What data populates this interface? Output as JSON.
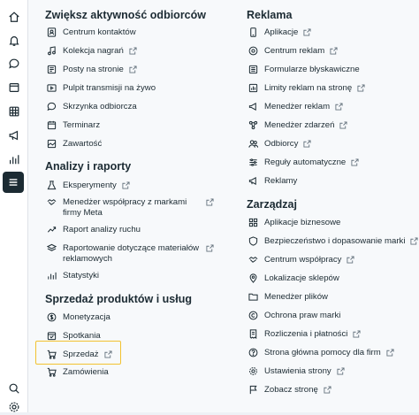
{
  "rail": {
    "icons": [
      "home-icon",
      "bell-icon",
      "chat-icon",
      "pages-icon",
      "table-icon",
      "megaphone-icon",
      "chart-icon",
      "menu-icon",
      "search-icon",
      "settings-icon"
    ]
  },
  "sections": {
    "engage": {
      "title": "Zwiększ aktywność odbiorców",
      "items": [
        {
          "label": "Centrum kontaktów",
          "icon": "contacts-icon",
          "external": false
        },
        {
          "label": "Kolekcja nagrań",
          "icon": "music-note-icon",
          "external": true
        },
        {
          "label": "Posty na stronie",
          "icon": "posts-icon",
          "external": true
        },
        {
          "label": "Pulpit transmisji na żywo",
          "icon": "live-icon",
          "external": false
        },
        {
          "label": "Skrzynka odbiorcza",
          "icon": "inbox-icon",
          "external": false
        },
        {
          "label": "Terminarz",
          "icon": "calendar-icon",
          "external": false
        },
        {
          "label": "Zawartość",
          "icon": "content-icon",
          "external": false
        }
      ]
    },
    "analytics": {
      "title": "Analizy i raporty",
      "items": [
        {
          "label": "Eksperymenty",
          "icon": "flask-icon",
          "external": true
        },
        {
          "label": "Menedżer współpracy z markami firmy Meta",
          "icon": "handshake-icon",
          "external": true
        },
        {
          "label": "Raport analizy ruchu",
          "icon": "traffic-icon",
          "external": false
        },
        {
          "label": "Raportowanie dotyczące materiałów reklamowych",
          "icon": "layers-icon",
          "external": true
        },
        {
          "label": "Statystyki",
          "icon": "stats-icon",
          "external": false
        }
      ]
    },
    "sales": {
      "title": "Sprzedaż produktów i usług",
      "items": [
        {
          "label": "Monetyzacja",
          "icon": "dollar-icon",
          "external": false
        },
        {
          "label": "Spotkania",
          "icon": "meeting-icon",
          "external": false
        },
        {
          "label": "Sprzedaż",
          "icon": "cart-icon",
          "external": true
        },
        {
          "label": "Zamówienia",
          "icon": "orders-icon",
          "external": false
        }
      ]
    },
    "ads": {
      "title": "Reklama",
      "items": [
        {
          "label": "Aplikacje",
          "icon": "phone-icon",
          "external": true
        },
        {
          "label": "Centrum reklam",
          "icon": "ads-center-icon",
          "external": true
        },
        {
          "label": "Formularze błyskawiczne",
          "icon": "form-icon",
          "external": false
        },
        {
          "label": "Limity reklam na stronę",
          "icon": "limit-icon",
          "external": true
        },
        {
          "label": "Menedżer reklam",
          "icon": "ads-manager-icon",
          "external": true
        },
        {
          "label": "Menedżer zdarzeń",
          "icon": "events-icon",
          "external": true
        },
        {
          "label": "Odbiorcy",
          "icon": "audience-icon",
          "external": true
        },
        {
          "label": "Reguły automatyczne",
          "icon": "rules-icon",
          "external": true
        },
        {
          "label": "Reklamy",
          "icon": "ads-icon",
          "external": false
        }
      ]
    },
    "manage": {
      "title": "Zarządzaj",
      "items": [
        {
          "label": "Aplikacje biznesowe",
          "icon": "apps-icon",
          "external": false
        },
        {
          "label": "Bezpieczeństwo i dopasowanie marki",
          "icon": "shield-icon",
          "external": true
        },
        {
          "label": "Centrum współpracy",
          "icon": "collab-icon",
          "external": true
        },
        {
          "label": "Lokalizacje sklepów",
          "icon": "location-icon",
          "external": false
        },
        {
          "label": "Menedżer plików",
          "icon": "folder-icon",
          "external": false
        },
        {
          "label": "Ochrona praw marki",
          "icon": "copyright-icon",
          "external": false
        },
        {
          "label": "Rozliczenia i płatności",
          "icon": "billing-icon",
          "external": true
        },
        {
          "label": "Strona główna pomocy dla firm",
          "icon": "help-icon",
          "external": true
        },
        {
          "label": "Ustawienia strony",
          "icon": "gear-icon",
          "external": true
        },
        {
          "label": "Zobacz stronę",
          "icon": "flag-icon",
          "external": true
        }
      ]
    }
  }
}
